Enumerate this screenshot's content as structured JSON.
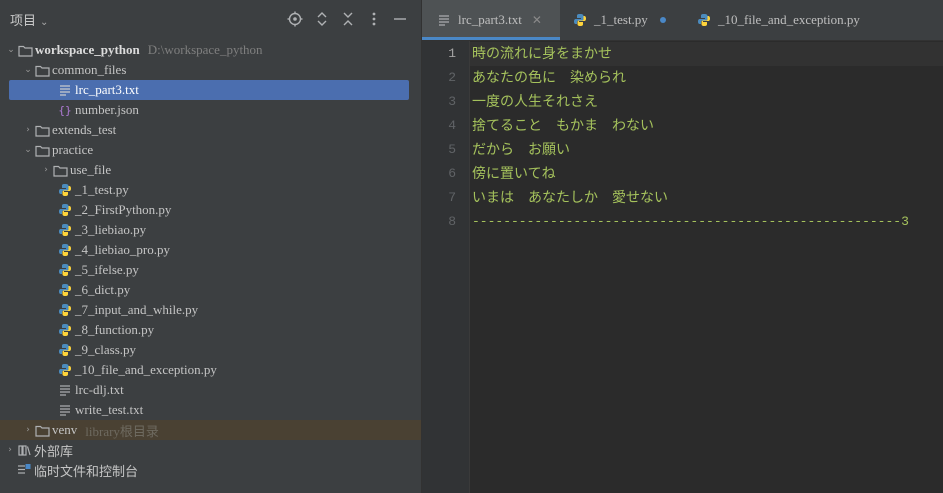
{
  "panel": {
    "title": "项目",
    "icons": [
      "locate-icon",
      "expand-collapse-icon",
      "collapse-all-icon",
      "more-icon",
      "minimize-icon"
    ]
  },
  "tree": {
    "root": {
      "label": "workspace_python",
      "path": "D:\\workspace_python"
    },
    "common_files": "common_files",
    "lrc_part3": "lrc_part3.txt",
    "number_json": "number.json",
    "extends_test": "extends_test",
    "practice": "practice",
    "use_file": "use_file",
    "py_files": [
      "_1_test.py",
      "_2_FirstPython.py",
      "_3_liebiao.py",
      "_4_liebiao_pro.py",
      "_5_ifelse.py",
      "_6_dict.py",
      "_7_input_and_while.py",
      "_8_function.py",
      "_9_class.py",
      "_10_file_and_exception.py"
    ],
    "lrc_dlj": "lrc-dlj.txt",
    "write_test": "write_test.txt",
    "venv": {
      "label": "venv",
      "path": "library根目录"
    },
    "external_libs": "外部库",
    "scratches": "临时文件和控制台"
  },
  "tabs": [
    {
      "label": "lrc_part3.txt",
      "active": true
    },
    {
      "label": "_1_test.py",
      "modified": true
    },
    {
      "label": "_10_file_and_exception.py"
    }
  ],
  "editor": {
    "line_numbers": [
      "1",
      "2",
      "3",
      "4",
      "5",
      "6",
      "7",
      "8"
    ],
    "lines": [
      "時の流れに身をまかせ",
      "あなたの色に　染められ",
      "一度の人生それさえ",
      "捨てること　もかま　わない",
      "だから　お願い",
      "傍に置いてね",
      "いまは　あなたしか　愛せない",
      "-------------------------------------------------------3"
    ]
  },
  "colors": {
    "panel_bg": "#3c3f41",
    "editor_bg": "#2b2b2b",
    "selection": "#4b6eaf",
    "text_green": "#a5c25c",
    "accent": "#4a88c7"
  }
}
